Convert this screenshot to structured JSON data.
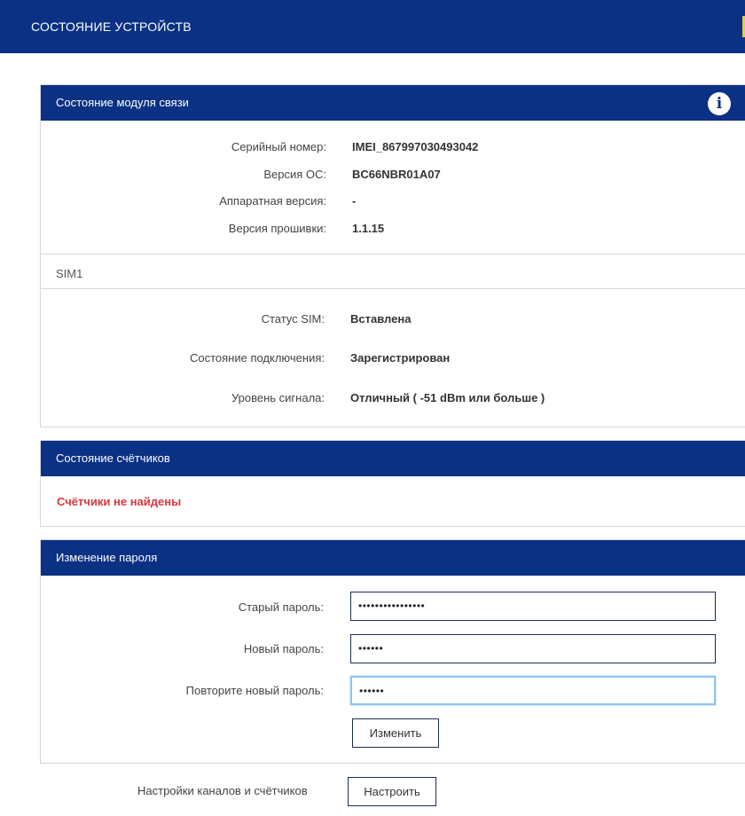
{
  "header": {
    "title": "СОСТОЯНИЕ УСТРОЙСТВ"
  },
  "module_panel": {
    "title": "Состояние модуля связи",
    "info_icon": "info-icon",
    "rows": [
      {
        "label": "Серийный номер:",
        "value": "IMEI_867997030493042"
      },
      {
        "label": "Версия ОС:",
        "value": "BC66NBR01A07"
      },
      {
        "label": "Аппаратная версия:",
        "value": "-"
      },
      {
        "label": "Версия прошивки:",
        "value": "1.1.15"
      }
    ],
    "sim": {
      "title": "SIM1",
      "rows": [
        {
          "label": "Статус SIM:",
          "value": "Вставлена"
        },
        {
          "label": "Состояние подключения:",
          "value": "Зарегистрирован"
        },
        {
          "label": "Уровень сигнала:",
          "value": "Отличный ( -51 dBm или больше )"
        }
      ]
    }
  },
  "counters_panel": {
    "title": "Состояние счётчиков",
    "message": "Счётчики не найдены"
  },
  "password_panel": {
    "title": "Изменение пароля",
    "old_label": "Старый пароль:",
    "old_value": "••••••••••••••••",
    "new_label": "Новый пароль:",
    "new_value": "••••••",
    "repeat_label": "Повторите новый пароль:",
    "repeat_value": "••••••",
    "submit_label": "Изменить"
  },
  "footer": {
    "label": "Настройки каналов и счётчиков",
    "button_label": "Настроить"
  },
  "colors": {
    "header_bg": "#0a3183",
    "error": "#d9363e",
    "focus": "#8ec5ef"
  }
}
